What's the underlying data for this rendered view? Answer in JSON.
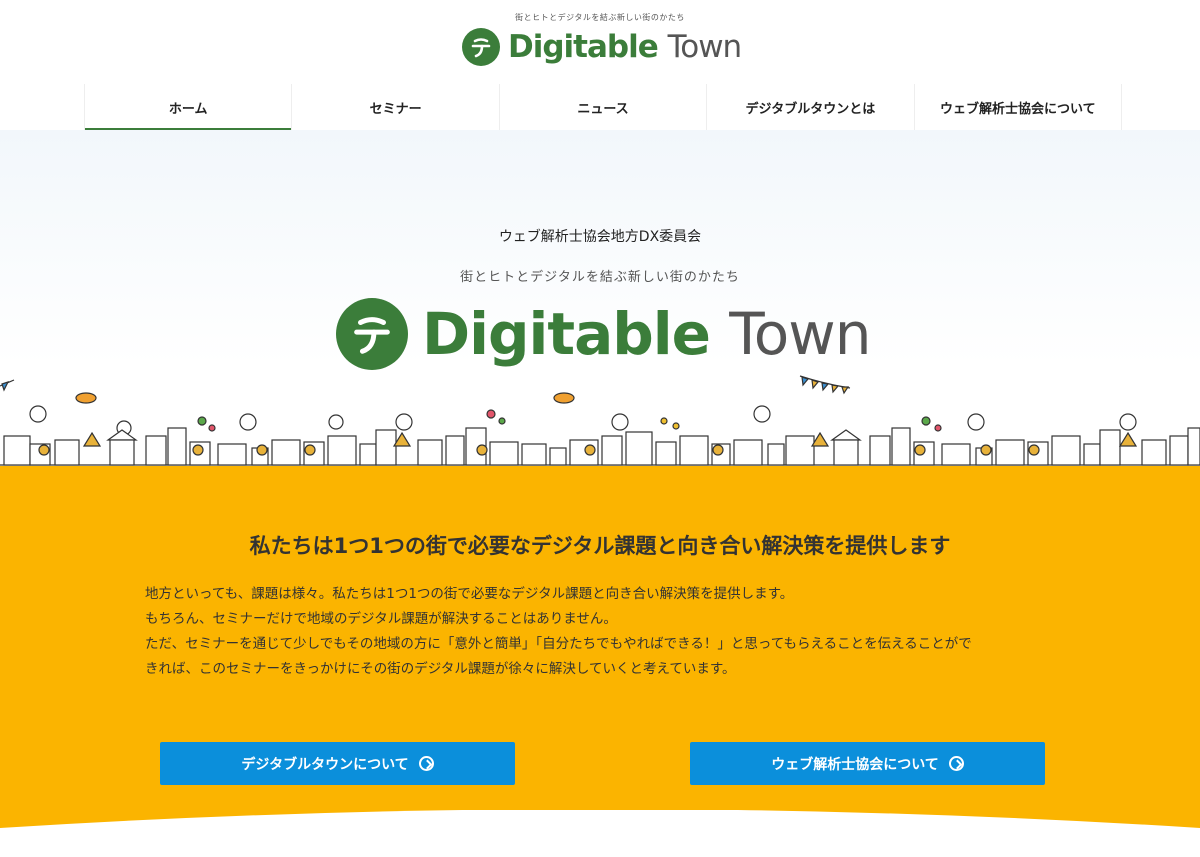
{
  "header": {
    "tagline": "街とヒトとデジタルを結ぶ新しい街のかたち",
    "logo_main": "Digitable",
    "logo_sub": "Town"
  },
  "nav": {
    "items": [
      {
        "label": "ホーム",
        "active": true
      },
      {
        "label": "セミナー"
      },
      {
        "label": "ニュース"
      },
      {
        "label": "デジタブルタウンとは"
      },
      {
        "label": "ウェブ解析士協会について"
      }
    ]
  },
  "hero": {
    "subtitle": "ウェブ解析士協会地方DX委員会",
    "tagline": "街とヒトとデジタルを結ぶ新しい街のかたち",
    "logo_main": "Digitable",
    "logo_sub": "Town"
  },
  "section": {
    "title": "私たちは1つ1つの街で必要なデジタル課題と向き合い解決策を提供します",
    "lines": [
      "地方といっても、課題は様々。私たちは1つ1つの街で必要なデジタル課題と向き合い解決策を提供します。",
      "もちろん、セミナーだけで地域のデジタル課題が解決することはありません。",
      "ただ、セミナーを通じて少しでもその地域の方に「意外と簡単」「自分たちでもやればできる！」と思ってもらえることを伝えることがで",
      "きれば、このセミナーをきっかけにその街のデジタル課題が徐々に解決していくと考えています。"
    ],
    "buttons": [
      {
        "label": "デジタブルタウンについて"
      },
      {
        "label": "ウェブ解析士協会について"
      }
    ]
  },
  "colors": {
    "brand_green": "#3b7d3a",
    "accent_yellow": "#fbb400",
    "button_blue": "#0b8fdb"
  }
}
